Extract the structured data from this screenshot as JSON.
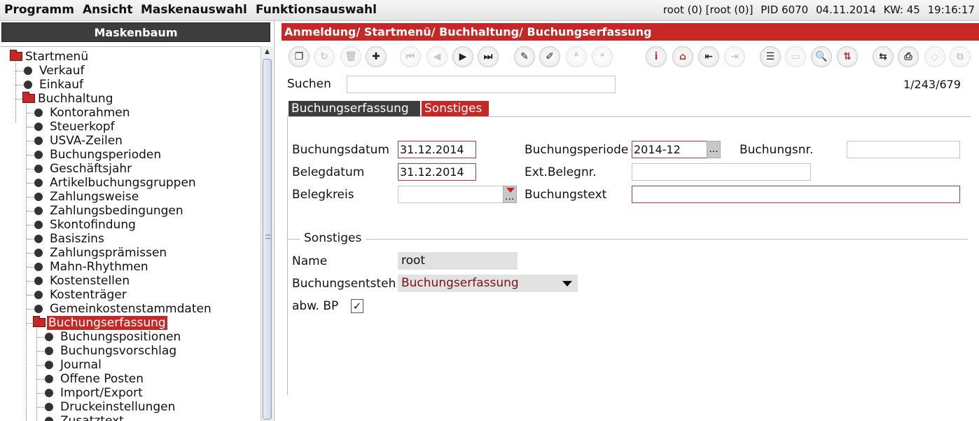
{
  "menubar": {
    "items": [
      "Programm",
      "Ansicht",
      "Maskenauswahl",
      "Funktionsauswahl"
    ],
    "status_user": "root (0) [root (0)]",
    "status_pid": "PID 6070",
    "status_date": "04.11.2014",
    "status_week": "KW: 45",
    "status_time": "19:16:17"
  },
  "sidebar": {
    "header": "Maskenbaum",
    "tree": [
      {
        "label": "Startmenü",
        "type": "folder",
        "level": 0
      },
      {
        "label": "Verkauf",
        "type": "leaf",
        "level": 1
      },
      {
        "label": "Einkauf",
        "type": "leaf",
        "level": 1
      },
      {
        "label": "Buchhaltung",
        "type": "folder",
        "level": 1
      },
      {
        "label": "Kontorahmen",
        "type": "leaf",
        "level": 2
      },
      {
        "label": "Steuerkopf",
        "type": "leaf",
        "level": 2
      },
      {
        "label": "USVA-Zeilen",
        "type": "leaf",
        "level": 2
      },
      {
        "label": "Buchungsperioden",
        "type": "leaf",
        "level": 2
      },
      {
        "label": "Geschäftsjahr",
        "type": "leaf",
        "level": 2
      },
      {
        "label": "Artikelbuchungsgruppen",
        "type": "leaf",
        "level": 2
      },
      {
        "label": "Zahlungsweise",
        "type": "leaf",
        "level": 2
      },
      {
        "label": "Zahlungsbedingungen",
        "type": "leaf",
        "level": 2
      },
      {
        "label": "Skontofindung",
        "type": "leaf",
        "level": 2
      },
      {
        "label": "Basiszins",
        "type": "leaf",
        "level": 2
      },
      {
        "label": "Zahlungsprämissen",
        "type": "leaf",
        "level": 2
      },
      {
        "label": "Mahn-Rhythmen",
        "type": "leaf",
        "level": 2
      },
      {
        "label": "Kostenstellen",
        "type": "leaf",
        "level": 2
      },
      {
        "label": "Kostenträger",
        "type": "leaf",
        "level": 2
      },
      {
        "label": "Gemeinkostenstammdaten",
        "type": "leaf",
        "level": 2
      },
      {
        "label": "Buchungserfassung",
        "type": "folder",
        "level": 2,
        "selected": true
      },
      {
        "label": "Buchungspositionen",
        "type": "leaf",
        "level": 3
      },
      {
        "label": "Buchungsvorschlag",
        "type": "leaf",
        "level": 3
      },
      {
        "label": "Journal",
        "type": "leaf",
        "level": 3
      },
      {
        "label": "Offene Posten",
        "type": "leaf",
        "level": 3
      },
      {
        "label": "Import/Export",
        "type": "leaf",
        "level": 3
      },
      {
        "label": "Druckeinstellungen",
        "type": "leaf",
        "level": 3
      },
      {
        "label": "Zusatztext",
        "type": "leaf",
        "level": 3
      }
    ]
  },
  "breadcrumb": "Anmeldung/ Startmenü/ Buchhaltung/ Buchungserfassung",
  "toolbar": {
    "buttons": [
      {
        "name": "window-restore-icon",
        "glyph": "❐",
        "enabled": true
      },
      {
        "name": "refresh-icon",
        "glyph": "↻",
        "enabled": false
      },
      {
        "name": "trash-icon",
        "glyph": "🗑",
        "enabled": false
      },
      {
        "name": "add-icon",
        "glyph": "✚",
        "enabled": true
      },
      {
        "name": "first-record-icon",
        "glyph": "⏮",
        "enabled": false
      },
      {
        "name": "previous-record-icon",
        "glyph": "◀",
        "enabled": false
      },
      {
        "name": "next-record-icon",
        "glyph": "▶",
        "enabled": true
      },
      {
        "name": "last-record-icon",
        "glyph": "⏭",
        "enabled": true
      },
      {
        "name": "edit-pencil-icon",
        "glyph": "✎",
        "enabled": true
      },
      {
        "name": "edit-field-icon",
        "glyph": "✐",
        "enabled": true
      },
      {
        "name": "replace-text-icon",
        "glyph": "ᴬ",
        "enabled": false
      },
      {
        "name": "find-text-icon",
        "glyph": "ᵃ",
        "enabled": false
      },
      {
        "name": "info-icon",
        "glyph": "i",
        "enabled": true,
        "accent": true
      },
      {
        "name": "home-icon",
        "glyph": "⌂",
        "enabled": true,
        "accent": true
      },
      {
        "name": "login-icon",
        "glyph": "⇤",
        "enabled": true
      },
      {
        "name": "logout-icon",
        "glyph": "⇥",
        "enabled": false
      },
      {
        "name": "list-icon",
        "glyph": "☰",
        "enabled": true
      },
      {
        "name": "table-icon",
        "glyph": "▭",
        "enabled": false
      },
      {
        "name": "search-icon",
        "glyph": "🔍",
        "enabled": true
      },
      {
        "name": "sort-az-icon",
        "glyph": "⇅",
        "enabled": true,
        "accent": true
      },
      {
        "name": "swap-icon",
        "glyph": "⇆",
        "enabled": true
      },
      {
        "name": "print-icon",
        "glyph": "⎙",
        "enabled": true
      },
      {
        "name": "tag-icon",
        "glyph": "◇",
        "enabled": false
      },
      {
        "name": "export-icon",
        "glyph": "⧉",
        "enabled": false
      }
    ]
  },
  "search": {
    "label": "Suchen",
    "value": ""
  },
  "record_count": "1/243/679",
  "tabs": [
    {
      "label": "Buchungserfassung",
      "active": false
    },
    {
      "label": "Sonstiges",
      "active": true
    }
  ],
  "form": {
    "buchungsdatum_label": "Buchungsdatum",
    "buchungsdatum_value": "31.12.2014",
    "belegdatum_label": "Belegdatum",
    "belegdatum_value": "31.12.2014",
    "belegkreis_label": "Belegkreis",
    "belegkreis_value": "",
    "buchungsperiode_label": "Buchungsperiode",
    "buchungsperiode_value": "2014-12",
    "ext_belegnr_label": "Ext.Belegnr.",
    "ext_belegnr_value": "",
    "buchungstext_label": "Buchungstext",
    "buchungstext_value": "",
    "buchungsnr_label": "Buchungsnr.",
    "buchungsnr_value": "",
    "dots": "..."
  },
  "sonstiges": {
    "group_title": "Sonstiges",
    "name_label": "Name",
    "name_value": "root",
    "entstehung_label": "Buchungsentsteh",
    "entstehung_value": "Buchungserfassung",
    "abw_bp_label": "abw. BP",
    "abw_bp_checked": true,
    "abw_bp_mark": "✓"
  },
  "colors": {
    "accent": "#c62828",
    "dark_header": "#3d3d3d",
    "readonly_bg": "#e2e2e2"
  }
}
